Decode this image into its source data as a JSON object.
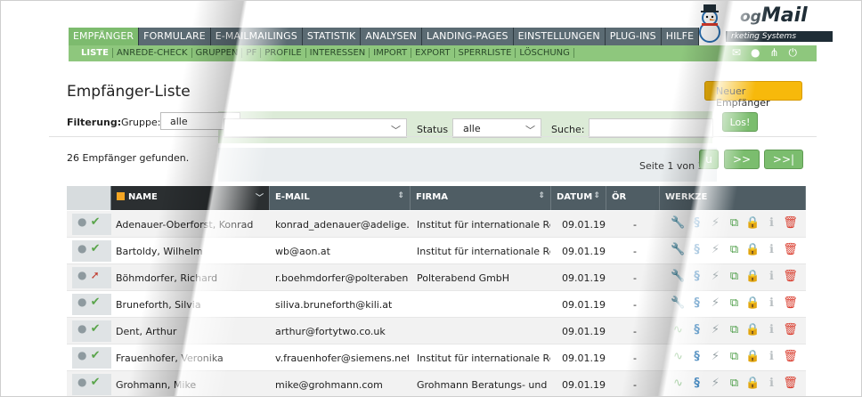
{
  "nav": {
    "items": [
      "EMPFÄNGER",
      "FORMULARE",
      "E-MAILMAILINGS",
      "STATISTIK",
      "ANALYSEN",
      "LANDING-PAGES",
      "EINSTELLUNGEN",
      "PLUG-INS",
      "HILFE"
    ],
    "active": "EMPFÄNGER"
  },
  "subnav": {
    "items": [
      "LISTE",
      "ANREDE-CHECK",
      "GRUPPEN",
      "PF",
      "PROFILE",
      "INTERESSEN",
      "IMPORT",
      "EXPORT",
      "SPERRLISTE",
      "LÖSCHUNG"
    ],
    "active": "LISTE"
  },
  "logo": {
    "text_prefix": "og",
    "text_main": "Mail",
    "subtitle": "rketing Systems"
  },
  "page": {
    "title": "Empfänger-Liste",
    "new_button": "Neuer Empfänger"
  },
  "filter": {
    "label": "Filterung:",
    "group_label": "Gruppe:",
    "group_value": "alle",
    "status_label": "Status",
    "status_value": "alle",
    "search_label": "Suche:",
    "search_button": "Los!"
  },
  "results": {
    "found_text": "26 Empfänger gefunden.",
    "page_info": "Seite 1 von 3",
    "btn_prev": "u",
    "btn_next": ">>",
    "btn_last": ">>|"
  },
  "table": {
    "headers": {
      "name": "NAME",
      "email": "E-MAIL",
      "firm": "FIRMA",
      "date": "DATUM",
      "or": "ÖR",
      "tools": "WERKZE"
    },
    "rows": [
      {
        "name": "Adenauer-Oberforst, Konrad",
        "email": "konrad_adenauer@adelige.at",
        "firm": "Institut für internationale Re...",
        "date": "09.01.19",
        "or": "-",
        "state": "ok"
      },
      {
        "name": "Bartoldy, Wilhelm",
        "email": "wb@aon.at",
        "firm": "Institut für internationale Re...",
        "date": "09.01.19",
        "or": "-",
        "state": "ok"
      },
      {
        "name": "Böhmdorfer, Richard",
        "email": "r.boehmdorfer@polterabend...",
        "firm": "Polterabend GmbH",
        "date": "09.01.19",
        "or": "-",
        "state": "out"
      },
      {
        "name": "Bruneforth, Silvia",
        "email": "siliva.bruneforth@kili.at",
        "firm": "",
        "date": "09.01.19",
        "or": "-",
        "state": "ok"
      },
      {
        "name": "Dent, Arthur",
        "email": "arthur@fortytwo.co.uk",
        "firm": "",
        "date": "09.01.19",
        "or": "-",
        "state": "ok"
      },
      {
        "name": "Frauenhofer, Veronika",
        "email": "v.frauenhofer@siemens.net",
        "firm": "Institut für internationale Re...",
        "date": "09.01.19",
        "or": "-",
        "state": "ok"
      },
      {
        "name": "Grohmann, Mike",
        "email": "mike@grohmann.com",
        "firm": "Grohmann Beratungs- und ...",
        "date": "09.01.19",
        "or": "-",
        "state": "ok"
      }
    ]
  },
  "colors": {
    "accent_green": "#7dbb6e",
    "nav_dark": "#5b6b73",
    "new_button": "#f7b90b"
  }
}
